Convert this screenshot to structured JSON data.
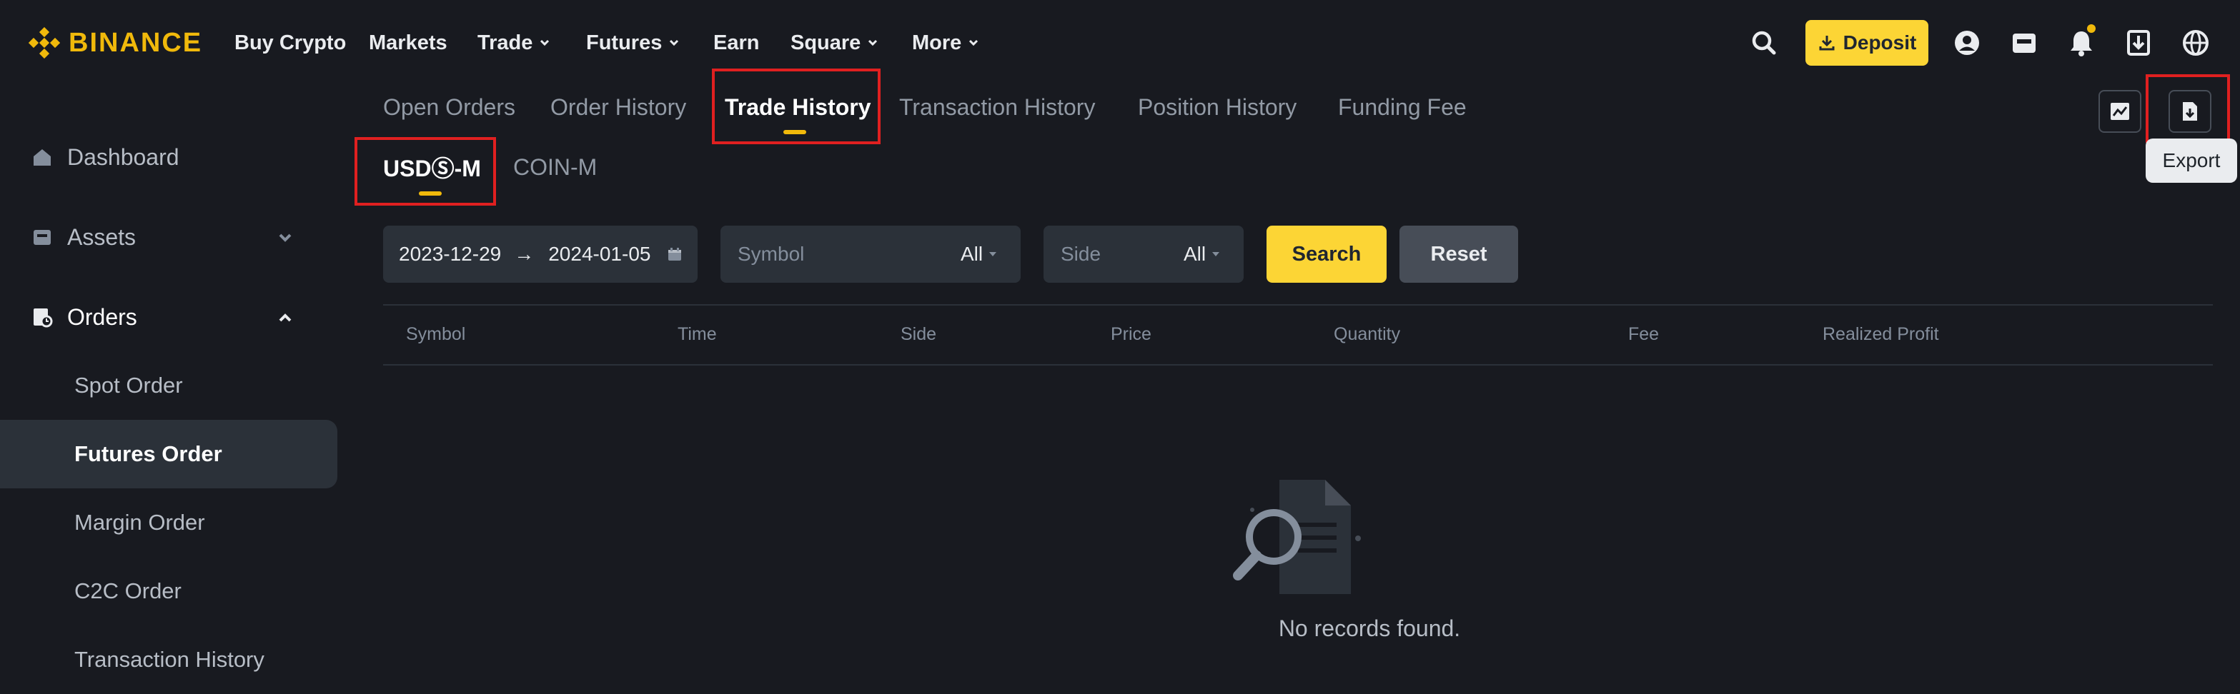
{
  "header": {
    "brand": "BINANCE",
    "nav": [
      {
        "label": "Buy Crypto"
      },
      {
        "label": "Markets"
      },
      {
        "label": "Trade"
      },
      {
        "label": "Futures"
      },
      {
        "label": "Earn"
      },
      {
        "label": "Square"
      },
      {
        "label": "More"
      }
    ],
    "deposit_label": "Deposit"
  },
  "sidebar": {
    "items": [
      {
        "label": "Dashboard"
      },
      {
        "label": "Assets"
      },
      {
        "label": "Orders"
      }
    ],
    "orders_sub": [
      {
        "label": "Spot Order"
      },
      {
        "label": "Futures Order"
      },
      {
        "label": "Margin Order"
      },
      {
        "label": "C2C Order"
      },
      {
        "label": "Transaction History"
      }
    ]
  },
  "tabs": [
    {
      "label": "Open Orders"
    },
    {
      "label": "Order History"
    },
    {
      "label": "Trade History"
    },
    {
      "label": "Transaction History"
    },
    {
      "label": "Position History"
    },
    {
      "label": "Funding Fee"
    }
  ],
  "sub_tabs": [
    {
      "label": "USDⓈ-M"
    },
    {
      "label": "COIN-M"
    }
  ],
  "tools": {
    "export_tooltip": "Export"
  },
  "filters": {
    "date_start": "2023-12-29",
    "date_arrow": "→",
    "date_end": "2024-01-05",
    "symbol_placeholder": "Symbol",
    "symbol_value": "All",
    "side_placeholder": "Side",
    "side_value": "All",
    "search_label": "Search",
    "reset_label": "Reset"
  },
  "table": {
    "columns": [
      "Symbol",
      "Time",
      "Side",
      "Price",
      "Quantity",
      "Fee",
      "Realized Profit"
    ],
    "empty_text": "No records found."
  },
  "colors": {
    "accent": "#fcd535",
    "brand": "#f0b90b",
    "background": "#181a20",
    "highlight_box": "#e02020"
  }
}
